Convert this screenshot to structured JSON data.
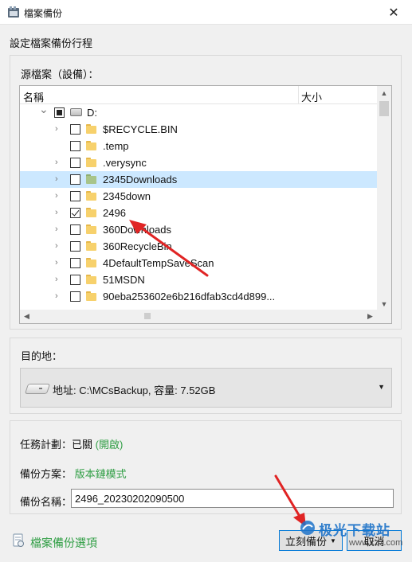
{
  "window": {
    "title": "檔案備份",
    "close_glyph": "✕"
  },
  "section_title": "設定檔案備份行程",
  "source": {
    "label": "源檔案（設備）：",
    "columns": {
      "name": "名稱",
      "size": "大小"
    },
    "rows": [
      {
        "label": "D:",
        "type": "drive",
        "expander": "expanded",
        "check": "partial"
      },
      {
        "label": "$RECYCLE.BIN",
        "type": "folder",
        "expander": "collapsed",
        "check": "unchecked"
      },
      {
        "label": ".temp",
        "type": "folder",
        "expander": "none",
        "check": "unchecked"
      },
      {
        "label": ".verysync",
        "type": "folder",
        "expander": "collapsed",
        "check": "unchecked"
      },
      {
        "label": "2345Downloads",
        "type": "folder-green",
        "expander": "collapsed",
        "check": "unchecked",
        "selected": true
      },
      {
        "label": "2345down",
        "type": "folder",
        "expander": "collapsed",
        "check": "unchecked"
      },
      {
        "label": "2496",
        "type": "folder",
        "expander": "collapsed",
        "check": "checked"
      },
      {
        "label": "360Downloads",
        "type": "folder",
        "expander": "collapsed",
        "check": "unchecked"
      },
      {
        "label": "360RecycleBin",
        "type": "folder",
        "expander": "collapsed",
        "check": "unchecked"
      },
      {
        "label": "4DefaultTempSaveScan",
        "type": "folder",
        "expander": "collapsed",
        "check": "unchecked"
      },
      {
        "label": "51MSDN",
        "type": "folder",
        "expander": "collapsed",
        "check": "unchecked"
      },
      {
        "label": "90eba253602e6b216dfab3cd4d899...",
        "type": "folder",
        "expander": "collapsed",
        "check": "unchecked"
      }
    ]
  },
  "destination": {
    "label": "目的地：",
    "value": "地址: C:\\MCsBackup, 容量: 7.52GB"
  },
  "schedule": {
    "label": "任務計劃：已關",
    "toggle": "(開啟)"
  },
  "scheme": {
    "label": "備份方案：",
    "value": "版本鏈模式"
  },
  "backup_name": {
    "label": "備份名稱：",
    "value": "2496_20230202090500"
  },
  "footer": {
    "options_link": "檔案備份選項",
    "backup_button": "立刻備份",
    "cancel_button": "取消"
  },
  "watermark": {
    "title": "极光下载站",
    "url": "www.xz7.com"
  },
  "colors": {
    "accent": "#0078d7",
    "link_green": "#2f9e44",
    "selected_row": "#cce8ff",
    "annotation_arrow": "#e02424"
  }
}
